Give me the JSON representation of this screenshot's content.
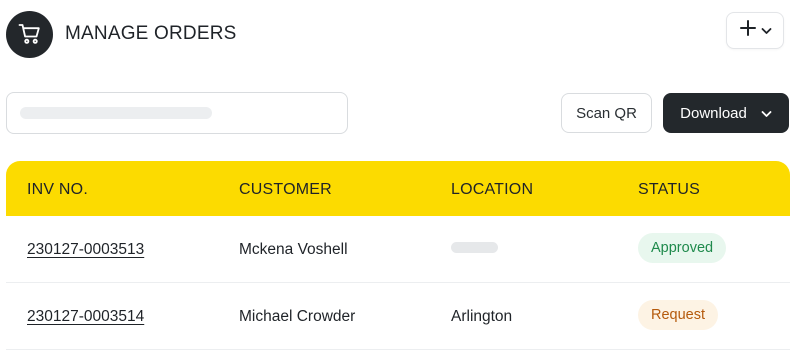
{
  "header": {
    "title": "MANAGE ORDERS",
    "cart_icon": "shopping-cart-icon",
    "add_icon": "plus-icon",
    "chevron_icon": "chevron-down-icon"
  },
  "toolbar": {
    "search_placeholder": "",
    "scan_label": "Scan QR",
    "download_label": "Download"
  },
  "table": {
    "header_color": "#fcdb00",
    "columns": [
      "INV NO.",
      "CUSTOMER",
      "LOCATION",
      "STATUS"
    ],
    "rows": [
      {
        "inv": "230127-0003513",
        "customer": "Mckena Voshell",
        "location": "",
        "status": "Approved",
        "status_color": "#1f8a4c"
      },
      {
        "inv": "230127-0003514",
        "customer": "Michael Crowder",
        "location": "Arlington",
        "status": "Request",
        "status_color": "#b55a0c"
      }
    ]
  }
}
